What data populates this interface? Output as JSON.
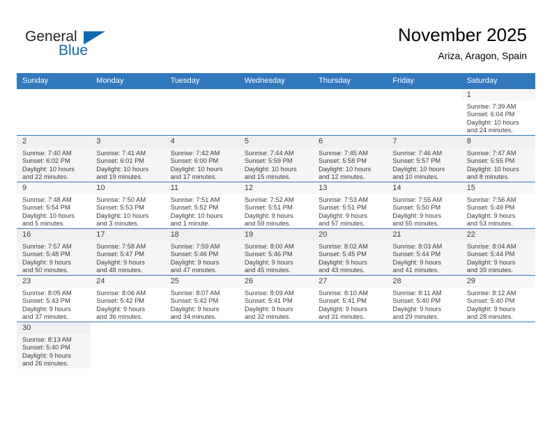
{
  "brand": {
    "name_top": "General",
    "name_bottom": "Blue",
    "triangle_icon": "triangle-icon",
    "accent_color": "#1269b0"
  },
  "header": {
    "title": "November 2025",
    "subtitle": "Ariza, Aragon, Spain"
  },
  "theme": {
    "header_row_bg": "#3278bd",
    "header_row_text": "#ffffff",
    "row_shade_bg": "#f5f5f5",
    "daynum_bg": "#f0f0f0",
    "grid_line": "#3278bd"
  },
  "weekdays": [
    "Sunday",
    "Monday",
    "Tuesday",
    "Wednesday",
    "Thursday",
    "Friday",
    "Saturday"
  ],
  "weeks": [
    [
      {
        "empty": true
      },
      {
        "empty": true
      },
      {
        "empty": true
      },
      {
        "empty": true
      },
      {
        "empty": true
      },
      {
        "empty": true
      },
      {
        "day": "1",
        "sunrise": "Sunrise: 7:39 AM",
        "sunset": "Sunset: 6:04 PM",
        "daylight1": "Daylight: 10 hours",
        "daylight2": "and 24 minutes."
      }
    ],
    [
      {
        "day": "2",
        "sunrise": "Sunrise: 7:40 AM",
        "sunset": "Sunset: 6:02 PM",
        "daylight1": "Daylight: 10 hours",
        "daylight2": "and 22 minutes."
      },
      {
        "day": "3",
        "sunrise": "Sunrise: 7:41 AM",
        "sunset": "Sunset: 6:01 PM",
        "daylight1": "Daylight: 10 hours",
        "daylight2": "and 19 minutes."
      },
      {
        "day": "4",
        "sunrise": "Sunrise: 7:42 AM",
        "sunset": "Sunset: 6:00 PM",
        "daylight1": "Daylight: 10 hours",
        "daylight2": "and 17 minutes."
      },
      {
        "day": "5",
        "sunrise": "Sunrise: 7:44 AM",
        "sunset": "Sunset: 5:59 PM",
        "daylight1": "Daylight: 10 hours",
        "daylight2": "and 15 minutes."
      },
      {
        "day": "6",
        "sunrise": "Sunrise: 7:45 AM",
        "sunset": "Sunset: 5:58 PM",
        "daylight1": "Daylight: 10 hours",
        "daylight2": "and 12 minutes."
      },
      {
        "day": "7",
        "sunrise": "Sunrise: 7:46 AM",
        "sunset": "Sunset: 5:57 PM",
        "daylight1": "Daylight: 10 hours",
        "daylight2": "and 10 minutes."
      },
      {
        "day": "8",
        "sunrise": "Sunrise: 7:47 AM",
        "sunset": "Sunset: 5:55 PM",
        "daylight1": "Daylight: 10 hours",
        "daylight2": "and 8 minutes."
      }
    ],
    [
      {
        "day": "9",
        "sunrise": "Sunrise: 7:48 AM",
        "sunset": "Sunset: 5:54 PM",
        "daylight1": "Daylight: 10 hours",
        "daylight2": "and 5 minutes."
      },
      {
        "day": "10",
        "sunrise": "Sunrise: 7:50 AM",
        "sunset": "Sunset: 5:53 PM",
        "daylight1": "Daylight: 10 hours",
        "daylight2": "and 3 minutes."
      },
      {
        "day": "11",
        "sunrise": "Sunrise: 7:51 AM",
        "sunset": "Sunset: 5:52 PM",
        "daylight1": "Daylight: 10 hours",
        "daylight2": "and 1 minute."
      },
      {
        "day": "12",
        "sunrise": "Sunrise: 7:52 AM",
        "sunset": "Sunset: 5:51 PM",
        "daylight1": "Daylight: 9 hours",
        "daylight2": "and 59 minutes."
      },
      {
        "day": "13",
        "sunrise": "Sunrise: 7:53 AM",
        "sunset": "Sunset: 5:51 PM",
        "daylight1": "Daylight: 9 hours",
        "daylight2": "and 57 minutes."
      },
      {
        "day": "14",
        "sunrise": "Sunrise: 7:55 AM",
        "sunset": "Sunset: 5:50 PM",
        "daylight1": "Daylight: 9 hours",
        "daylight2": "and 55 minutes."
      },
      {
        "day": "15",
        "sunrise": "Sunrise: 7:56 AM",
        "sunset": "Sunset: 5:49 PM",
        "daylight1": "Daylight: 9 hours",
        "daylight2": "and 53 minutes."
      }
    ],
    [
      {
        "day": "16",
        "sunrise": "Sunrise: 7:57 AM",
        "sunset": "Sunset: 5:48 PM",
        "daylight1": "Daylight: 9 hours",
        "daylight2": "and 50 minutes."
      },
      {
        "day": "17",
        "sunrise": "Sunrise: 7:58 AM",
        "sunset": "Sunset: 5:47 PM",
        "daylight1": "Daylight: 9 hours",
        "daylight2": "and 48 minutes."
      },
      {
        "day": "18",
        "sunrise": "Sunrise: 7:59 AM",
        "sunset": "Sunset: 5:46 PM",
        "daylight1": "Daylight: 9 hours",
        "daylight2": "and 47 minutes."
      },
      {
        "day": "19",
        "sunrise": "Sunrise: 8:00 AM",
        "sunset": "Sunset: 5:46 PM",
        "daylight1": "Daylight: 9 hours",
        "daylight2": "and 45 minutes."
      },
      {
        "day": "20",
        "sunrise": "Sunrise: 8:02 AM",
        "sunset": "Sunset: 5:45 PM",
        "daylight1": "Daylight: 9 hours",
        "daylight2": "and 43 minutes."
      },
      {
        "day": "21",
        "sunrise": "Sunrise: 8:03 AM",
        "sunset": "Sunset: 5:44 PM",
        "daylight1": "Daylight: 9 hours",
        "daylight2": "and 41 minutes."
      },
      {
        "day": "22",
        "sunrise": "Sunrise: 8:04 AM",
        "sunset": "Sunset: 5:44 PM",
        "daylight1": "Daylight: 9 hours",
        "daylight2": "and 39 minutes."
      }
    ],
    [
      {
        "day": "23",
        "sunrise": "Sunrise: 8:05 AM",
        "sunset": "Sunset: 5:43 PM",
        "daylight1": "Daylight: 9 hours",
        "daylight2": "and 37 minutes."
      },
      {
        "day": "24",
        "sunrise": "Sunrise: 8:06 AM",
        "sunset": "Sunset: 5:42 PM",
        "daylight1": "Daylight: 9 hours",
        "daylight2": "and 36 minutes."
      },
      {
        "day": "25",
        "sunrise": "Sunrise: 8:07 AM",
        "sunset": "Sunset: 5:42 PM",
        "daylight1": "Daylight: 9 hours",
        "daylight2": "and 34 minutes."
      },
      {
        "day": "26",
        "sunrise": "Sunrise: 8:09 AM",
        "sunset": "Sunset: 5:41 PM",
        "daylight1": "Daylight: 9 hours",
        "daylight2": "and 32 minutes."
      },
      {
        "day": "27",
        "sunrise": "Sunrise: 8:10 AM",
        "sunset": "Sunset: 5:41 PM",
        "daylight1": "Daylight: 9 hours",
        "daylight2": "and 31 minutes."
      },
      {
        "day": "28",
        "sunrise": "Sunrise: 8:11 AM",
        "sunset": "Sunset: 5:40 PM",
        "daylight1": "Daylight: 9 hours",
        "daylight2": "and 29 minutes."
      },
      {
        "day": "29",
        "sunrise": "Sunrise: 8:12 AM",
        "sunset": "Sunset: 5:40 PM",
        "daylight1": "Daylight: 9 hours",
        "daylight2": "and 28 minutes."
      }
    ],
    [
      {
        "day": "30",
        "sunrise": "Sunrise: 8:13 AM",
        "sunset": "Sunset: 5:40 PM",
        "daylight1": "Daylight: 9 hours",
        "daylight2": "and 26 minutes."
      },
      {
        "empty": true
      },
      {
        "empty": true
      },
      {
        "empty": true
      },
      {
        "empty": true
      },
      {
        "empty": true
      },
      {
        "empty": true
      }
    ]
  ]
}
